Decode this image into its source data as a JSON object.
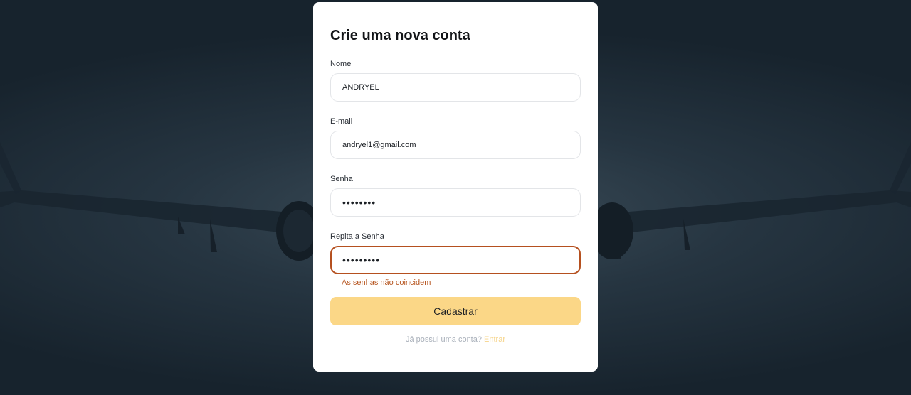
{
  "form": {
    "title": "Crie uma nova conta",
    "name_label": "Nome",
    "name_value": "ANDRYEL",
    "email_label": "E-mail",
    "email_value": "andryel1@gmail.com",
    "password_label": "Senha",
    "password_value": "12345678",
    "repeat_password_label": "Repita a Senha",
    "repeat_password_value": "123456789",
    "repeat_password_error": "As senhas não coincidem",
    "submit_label": "Cadastrar",
    "footer_text": "Já possui uma conta?",
    "footer_link": "Entrar"
  },
  "colors": {
    "accent": "#fbd787",
    "error": "#b5501f",
    "link": "#f6d48a"
  },
  "background": {
    "image": "airplane-background"
  }
}
